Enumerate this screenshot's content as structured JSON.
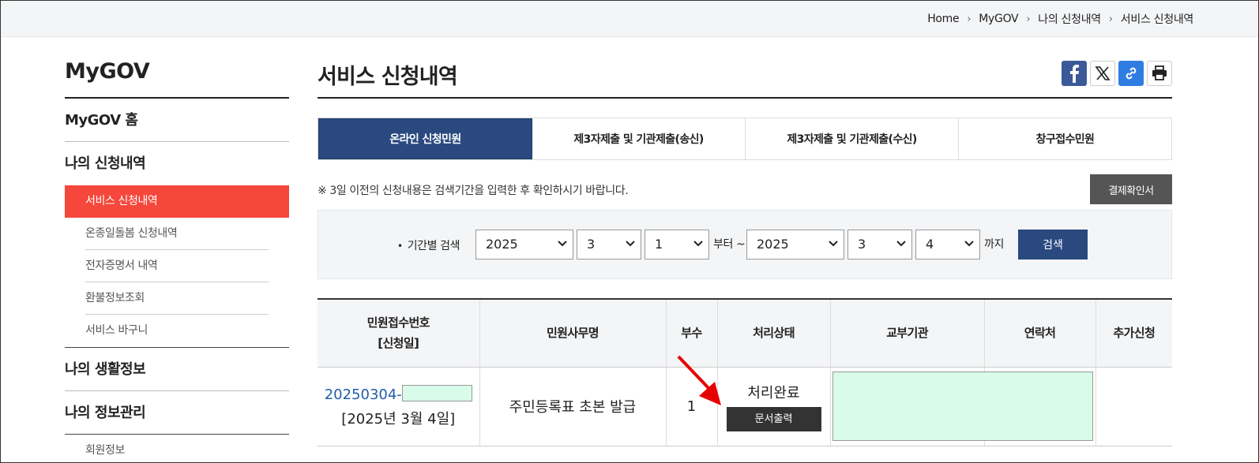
{
  "breadcrumb": [
    "Home",
    "MyGOV",
    "나의 신청내역",
    "서비스 신청내역"
  ],
  "sidebar": {
    "title": "MyGOV",
    "home": "MyGOV 홈",
    "group1": {
      "label": "나의 신청내역",
      "items": [
        "서비스 신청내역",
        "온종일돌봄 신청내역",
        "전자증명서 내역",
        "환불정보조회",
        "서비스 바구니"
      ]
    },
    "group2": {
      "label": "나의 생활정보"
    },
    "group3": {
      "label": "나의 정보관리",
      "items": [
        "회원정보"
      ]
    }
  },
  "page": {
    "title": "서비스 신청내역"
  },
  "tabs": [
    "온라인 신청민원",
    "제3자제출 및 기관제출(송신)",
    "제3자제출 및 기관제출(수신)",
    "창구접수민원"
  ],
  "notice": "※ 3일 이전의 신청내용은 검색기간을 입력한 후 확인하시기 바랍니다.",
  "receipt_button": "결제확인서",
  "search": {
    "label": "기간별 검색",
    "from": {
      "year": "2025",
      "month": "3",
      "day": "1"
    },
    "from_word": "부터 ~",
    "to": {
      "year": "2025",
      "month": "3",
      "day": "4"
    },
    "to_word": "까지",
    "button": "검색"
  },
  "table": {
    "headers": [
      "민원접수번호\n[신청일]",
      "민원사무명",
      "부수",
      "처리상태",
      "교부기관",
      "연락처",
      "추가신청"
    ],
    "header_line1": "민원접수번호",
    "header_line2": "[신청일]",
    "rows": [
      {
        "req_no": "20250304-",
        "req_date": "[2025년 3월 4일]",
        "service": "주민등록표 초본 발급",
        "copies": "1",
        "status": "처리완료",
        "print_button": "문서출력"
      }
    ]
  },
  "colors": {
    "accent_red": "#f5473b",
    "navy": "#2a4a7f",
    "highlight_mask": "#d9fbea",
    "arrow": "#e60000"
  }
}
